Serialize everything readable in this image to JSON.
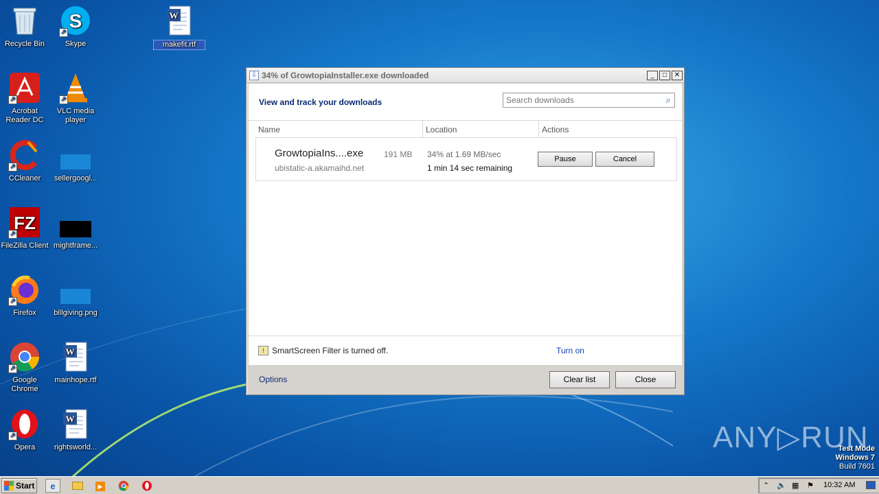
{
  "desktop": {
    "icons": [
      {
        "label": "Recycle Bin",
        "icon": "recycle-bin-icon"
      },
      {
        "label": "Skype",
        "icon": "skype-icon"
      },
      {
        "label": "makefit.rtf",
        "icon": "word-document-icon"
      },
      {
        "label": "Acrobat Reader DC",
        "icon": "acrobat-icon"
      },
      {
        "label": "VLC media player",
        "icon": "vlc-icon"
      },
      {
        "label": "CCleaner",
        "icon": "ccleaner-icon"
      },
      {
        "label": "sellergoogl...",
        "icon": "blank-file-icon"
      },
      {
        "label": "FileZilla Client",
        "icon": "filezilla-icon"
      },
      {
        "label": "mightframe...",
        "icon": "black-image-icon"
      },
      {
        "label": "Firefox",
        "icon": "firefox-icon"
      },
      {
        "label": "billgiving.png",
        "icon": "image-file-icon"
      },
      {
        "label": "Google Chrome",
        "icon": "chrome-icon"
      },
      {
        "label": "mainhope.rtf",
        "icon": "word-document-icon"
      },
      {
        "label": "Opera",
        "icon": "opera-icon"
      },
      {
        "label": "rightsworld...",
        "icon": "word-document-icon"
      }
    ]
  },
  "dialog": {
    "title": "34% of GrowtopiaInstaller.exe downloaded",
    "heading": "View and track your downloads",
    "search_placeholder": "Search downloads",
    "columns": {
      "name": "Name",
      "location": "Location",
      "actions": "Actions"
    },
    "download": {
      "filename": "GrowtopiaIns....exe",
      "size": "191 MB",
      "host": "ubistatic-a.akamaihd.net",
      "progress_text": "34% at 1.69 MB/sec",
      "remaining": "1 min 14 sec remaining",
      "pause_label": "Pause",
      "cancel_label": "Cancel"
    },
    "smartscreen": {
      "text": "SmartScreen Filter is turned off.",
      "link": "Turn on"
    },
    "footer": {
      "options": "Options",
      "clear_list": "Clear list",
      "close": "Close"
    }
  },
  "watermark": {
    "text": "ANY▷RUN"
  },
  "test_mode": {
    "line1": "Test Mode",
    "line2": "Windows 7",
    "line3": "Build 7601"
  },
  "taskbar": {
    "start_label": "Start",
    "pinned": [
      "internet-explorer-icon",
      "explorer-folder-icon",
      "media-player-icon",
      "chrome-icon",
      "opera-icon"
    ],
    "clock": "10:32 AM"
  }
}
